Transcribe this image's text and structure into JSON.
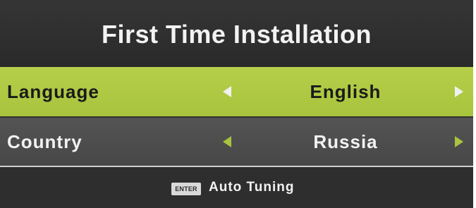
{
  "screen": {
    "title": "First Time Installation"
  },
  "settings": [
    {
      "label": "Language",
      "value": "English",
      "selected": true
    },
    {
      "label": "Country",
      "value": "Russia",
      "selected": false
    }
  ],
  "footer": {
    "key_label": "ENTER",
    "action_label": "Auto Tuning"
  },
  "colors": {
    "highlight": "#b0c944",
    "arrow_accent": "#a9c43e",
    "background": "#2f2f2f"
  },
  "icons": {
    "left": "triangle-left-icon",
    "right": "triangle-right-icon"
  }
}
